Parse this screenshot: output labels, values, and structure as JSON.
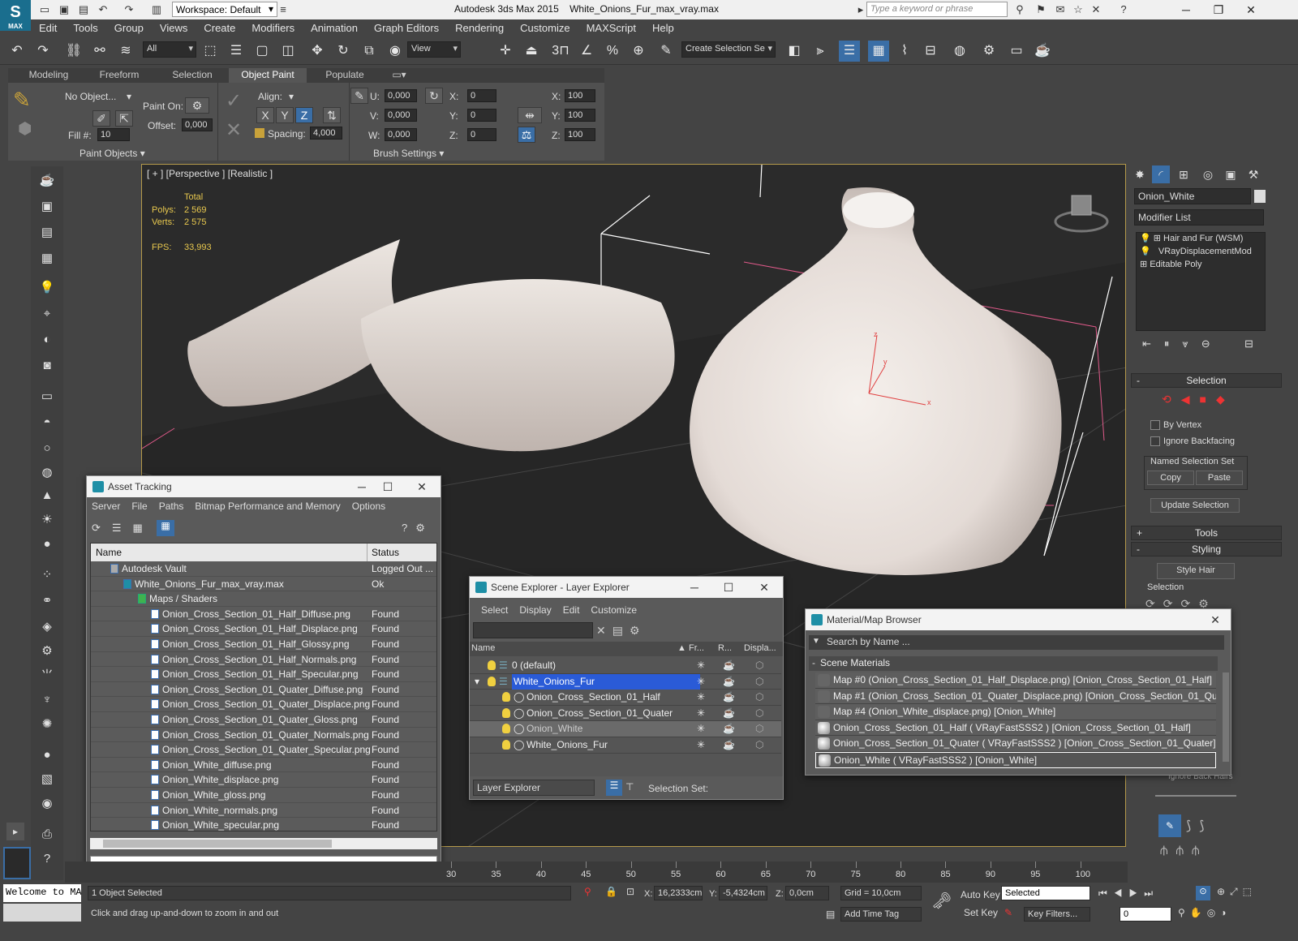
{
  "app": {
    "title": "Autodesk 3ds Max  2015",
    "file": "White_Onions_Fur_max_vray.max",
    "logo": "MAX",
    "workspace": "Workspace: Default",
    "search_placeholder": "Type a keyword or phrase"
  },
  "menu": [
    "Edit",
    "Tools",
    "Group",
    "Views",
    "Create",
    "Modifiers",
    "Animation",
    "Graph Editors",
    "Rendering",
    "Customize",
    "MAXScript",
    "Help"
  ],
  "toolbar": {
    "filter": "All",
    "refcoord": "View",
    "selset_placeholder": "Create Selection Se",
    "snaps": [
      "3",
      "%"
    ]
  },
  "ribbon": {
    "tabs": [
      "Modeling",
      "Freeform",
      "Selection",
      "Object Paint",
      "Populate"
    ],
    "active_tab": "Object Paint",
    "no_object": "No Object...",
    "paint_on": "Paint On:",
    "offset_label": "Offset:",
    "offset": "0,000",
    "fill_label": "Fill #:",
    "fill": "10",
    "align_label": "Align:",
    "axes": [
      "X",
      "Y",
      "Z"
    ],
    "spacing_label": "Spacing:",
    "spacing": "4,000",
    "uvw": [
      {
        "l": "U:",
        "v": "0,000"
      },
      {
        "l": "V:",
        "v": "0,000"
      },
      {
        "l": "W:",
        "v": "0,000"
      }
    ],
    "xyz": [
      {
        "l": "X:",
        "v": "0"
      },
      {
        "l": "Y:",
        "v": "0"
      },
      {
        "l": "Z:",
        "v": "0"
      }
    ],
    "scale": [
      {
        "l": "X:",
        "v": "100"
      },
      {
        "l": "Y:",
        "v": "100"
      },
      {
        "l": "Z:",
        "v": "100"
      }
    ],
    "group1": "Paint Objects",
    "group2": "Brush Settings"
  },
  "viewport": {
    "label": "[ + ] [Perspective ] [Realistic ]",
    "stats_total": "Total",
    "polys_label": "Polys:",
    "polys": "2 569",
    "verts_label": "Verts:",
    "verts": "2 575",
    "fps_label": "FPS:",
    "fps": "33,993",
    "gizmo": [
      "z",
      "y",
      "x"
    ]
  },
  "command_panel": {
    "object_name": "Onion_White",
    "modifier_list": "Modifier List",
    "modifiers": [
      "Hair and Fur (WSM)",
      "VRayDisplacementMod",
      "Editable Poly"
    ],
    "selection_rollout": "Selection",
    "by_vertex": "By Vertex",
    "ignore_backfacing": "Ignore Backfacing",
    "named_sel": "Named Selection Set",
    "copy": "Copy",
    "paste": "Paste",
    "update_selection": "Update Selection",
    "tools_rollout": "Tools",
    "styling_rollout": "Styling",
    "style_hair": "Style Hair",
    "selection_sub": "Selection",
    "ignore_back_hairs": "Ignore Back Hairs"
  },
  "asset_tracking": {
    "title": "Asset Tracking",
    "menu": [
      "Server",
      "File",
      "Paths",
      "Bitmap Performance and Memory",
      "Options"
    ],
    "col_name": "Name",
    "col_status": "Status",
    "vault": {
      "name": "Autodesk Vault",
      "status": "Logged Out ..."
    },
    "file": {
      "name": "White_Onions_Fur_max_vray.max",
      "status": "Ok"
    },
    "folder": "Maps / Shaders",
    "maps": [
      {
        "name": "Onion_Cross_Section_01_Half_Diffuse.png",
        "status": "Found"
      },
      {
        "name": "Onion_Cross_Section_01_Half_Displace.png",
        "status": "Found"
      },
      {
        "name": "Onion_Cross_Section_01_Half_Glossy.png",
        "status": "Found"
      },
      {
        "name": "Onion_Cross_Section_01_Half_Normals.png",
        "status": "Found"
      },
      {
        "name": "Onion_Cross_Section_01_Half_Specular.png",
        "status": "Found"
      },
      {
        "name": "Onion_Cross_Section_01_Quater_Diffuse.png",
        "status": "Found"
      },
      {
        "name": "Onion_Cross_Section_01_Quater_Displace.png",
        "status": "Found"
      },
      {
        "name": "Onion_Cross_Section_01_Quater_Gloss.png",
        "status": "Found"
      },
      {
        "name": "Onion_Cross_Section_01_Quater_Normals.png",
        "status": "Found"
      },
      {
        "name": "Onion_Cross_Section_01_Quater_Specular.png",
        "status": "Found"
      },
      {
        "name": "Onion_White_diffuse.png",
        "status": "Found"
      },
      {
        "name": "Onion_White_displace.png",
        "status": "Found"
      },
      {
        "name": "Onion_White_gloss.png",
        "status": "Found"
      },
      {
        "name": "Onion_White_normals.png",
        "status": "Found"
      },
      {
        "name": "Onion_White_specular.png",
        "status": "Found"
      }
    ]
  },
  "scene_explorer": {
    "title": "Scene Explorer - Layer Explorer",
    "menu": [
      "Select",
      "Display",
      "Edit",
      "Customize"
    ],
    "cols": [
      "Name",
      "Fr...",
      "R...",
      "Displa..."
    ],
    "rows": [
      {
        "name": "0 (default)",
        "indent": 0
      },
      {
        "name": "White_Onions_Fur",
        "indent": 0,
        "selected": true
      },
      {
        "name": "Onion_Cross_Section_01_Half",
        "indent": 1
      },
      {
        "name": "Onion_Cross_Section_01_Quater",
        "indent": 1
      },
      {
        "name": "Onion_White",
        "indent": 1,
        "hl": true
      },
      {
        "name": "White_Onions_Fur",
        "indent": 1
      }
    ],
    "footer": "Layer Explorer",
    "selection_set": "Selection Set:"
  },
  "material_browser": {
    "title": "Material/Map Browser",
    "search": "Search by Name ...",
    "group": "Scene Materials",
    "items": [
      "Map #0 (Onion_Cross_Section_01_Half_Displace.png) [Onion_Cross_Section_01_Half]",
      "Map #1 (Onion_Cross_Section_01_Quater_Displace.png) [Onion_Cross_Section_01_Quater]",
      "Map #4 (Onion_White_displace.png) [Onion_White]",
      "Onion_Cross_Section_01_Half  ( VRayFastSSS2 ) [Onion_Cross_Section_01_Half]",
      "Onion_Cross_Section_01_Quater  ( VRayFastSSS2 ) [Onion_Cross_Section_01_Quater]",
      "Onion_White  ( VRayFastSSS2 ) [Onion_White]"
    ]
  },
  "timeline": {
    "ticks": [
      "30",
      "35",
      "40",
      "45",
      "50",
      "55",
      "60",
      "65",
      "70",
      "75",
      "80",
      "85",
      "90",
      "95",
      "100"
    ]
  },
  "status": {
    "listener": "Welcome to MA",
    "selected": "1 Object Selected",
    "prompt": "Click and drag up-and-down to zoom in and out",
    "x_label": "X:",
    "x": "16,2333cm",
    "y_label": "Y:",
    "y": "-5,4324cm",
    "z_label": "Z:",
    "z": "0,0cm",
    "grid": "Grid = 10,0cm",
    "add_time_tag": "Add Time Tag",
    "auto_key": "Auto Key",
    "set_key": "Set Key",
    "key_mode": "Selected",
    "key_filters": "Key Filters...",
    "frame": "0"
  },
  "colors": {
    "accent": "#1e8fa6",
    "selection": "#2a5bd7",
    "stats": "#e8c84e"
  }
}
